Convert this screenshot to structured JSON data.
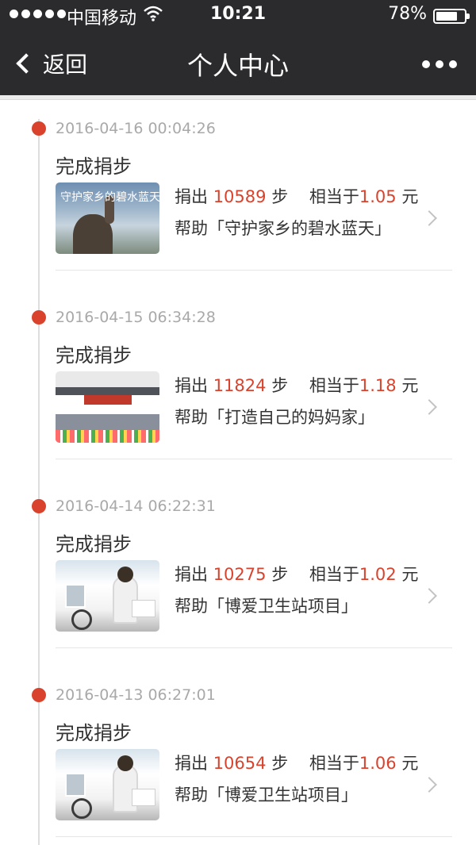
{
  "status_bar": {
    "carrier": "中国移动",
    "time": "10:21",
    "battery": "78%",
    "battery_level": 0.78
  },
  "nav": {
    "back_label": "返回",
    "title": "个人中心"
  },
  "entries": [
    {
      "date": "2016-04-16 00:04:26",
      "action": "完成捐步",
      "donate_prefix": "捐出",
      "steps": "10589",
      "steps_unit": "步",
      "equal_prefix": "相当于",
      "amount": "1.05",
      "amount_unit": "元",
      "help_prefix": "帮助",
      "project": "「守护家乡的碧水蓝天」",
      "thumb_caption": "守护家乡的碧水蓝天"
    },
    {
      "date": "2016-04-15 06:34:28",
      "action": "完成捐步",
      "donate_prefix": "捐出",
      "steps": "11824",
      "steps_unit": "步",
      "equal_prefix": "相当于",
      "amount": "1.18",
      "amount_unit": "元",
      "help_prefix": "帮助",
      "project": "「打造自己的妈妈家」"
    },
    {
      "date": "2016-04-14 06:22:31",
      "action": "完成捐步",
      "donate_prefix": "捐出",
      "steps": "10275",
      "steps_unit": "步",
      "equal_prefix": "相当于",
      "amount": "1.02",
      "amount_unit": "元",
      "help_prefix": "帮助",
      "project": "「博爱卫生站项目」"
    },
    {
      "date": "2016-04-13 06:27:01",
      "action": "完成捐步",
      "donate_prefix": "捐出",
      "steps": "10654",
      "steps_unit": "步",
      "equal_prefix": "相当于",
      "amount": "1.06",
      "amount_unit": "元",
      "help_prefix": "帮助",
      "project": "「博爱卫生站项目」"
    }
  ],
  "colors": {
    "bar_background": "#2b2b2d",
    "accent_red": "#d9432d",
    "date_gray": "#a9a9a9"
  }
}
